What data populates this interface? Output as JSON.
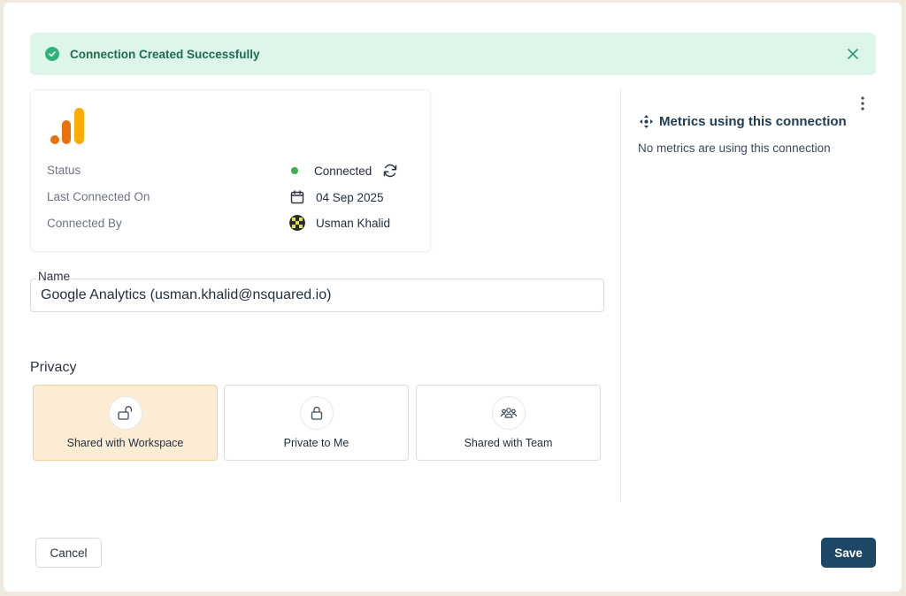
{
  "alert": {
    "message": "Connection Created Successfully",
    "icon": "check-circle-icon",
    "color": "#def5ea"
  },
  "connection": {
    "logo": "google-analytics-logo",
    "status_label": "Status",
    "status_value": "Connected",
    "last_connected_label": "Last Connected On",
    "last_connected_value": "04 Sep 2025",
    "connected_by_label": "Connected By",
    "connected_by_value": "Usman Khalid"
  },
  "name_field": {
    "label": "Name",
    "value": "Google Analytics (usman.khalid@nsquared.io)"
  },
  "privacy": {
    "title": "Privacy",
    "selected": "Shared with Workspace",
    "options": [
      {
        "label": "Shared with Workspace",
        "icon": "unlock-icon"
      },
      {
        "label": "Private to Me",
        "icon": "lock-icon"
      },
      {
        "label": "Shared with Team",
        "icon": "team-icon"
      }
    ]
  },
  "metrics": {
    "title": "Metrics using this connection",
    "empty_text": "No metrics are using this connection"
  },
  "footer": {
    "cancel_label": "Cancel",
    "save_label": "Save"
  },
  "colors": {
    "accent": "#1d4766",
    "success": "#35b24a",
    "selected_option": "#fdecd4"
  }
}
